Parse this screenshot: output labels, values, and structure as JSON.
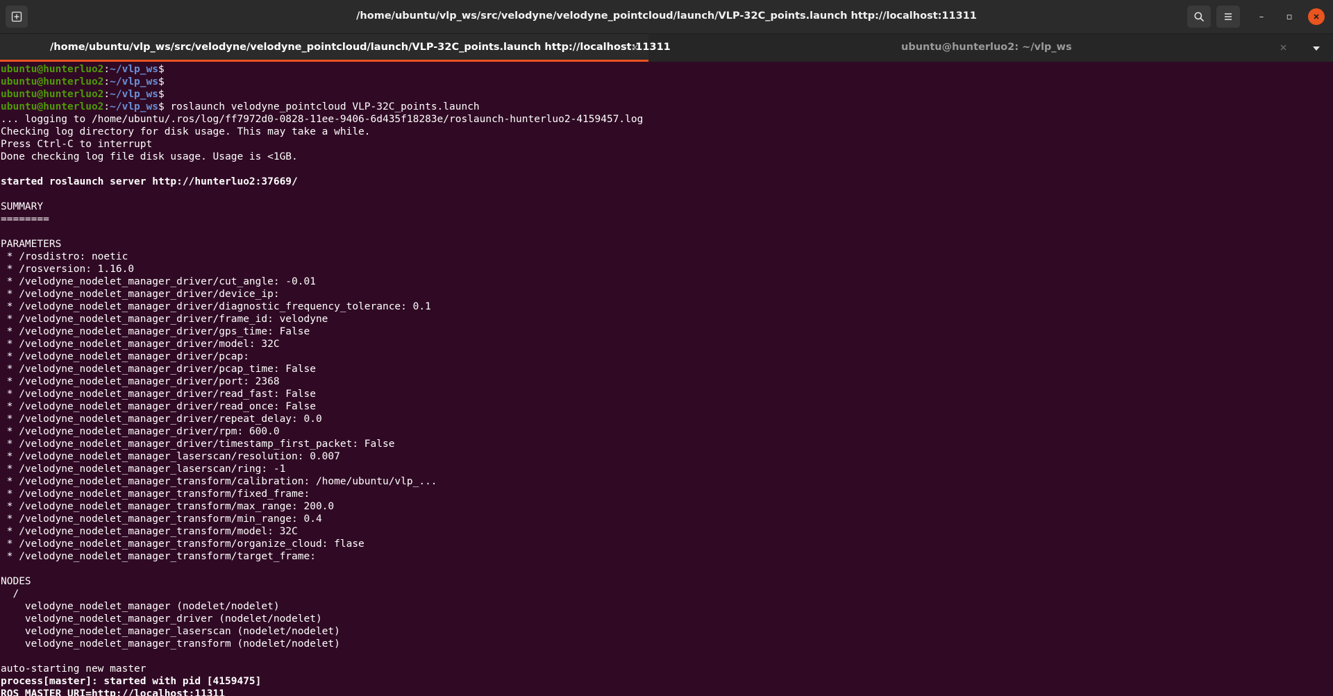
{
  "window": {
    "title": "/home/ubuntu/vlp_ws/src/velodyne/velodyne_pointcloud/launch/VLP-32C_points.launch http://localhost:11311"
  },
  "toolbar": {
    "new_tab_icon": "new-tab-icon",
    "search_icon": "search-icon",
    "menu_icon": "hamburger-menu-icon",
    "minimize_glyph": "–",
    "maximize_glyph": "▫",
    "close_glyph": "✕"
  },
  "tabs": [
    {
      "label": "/home/ubuntu/vlp_ws/src/velodyne/velodyne_pointcloud/launch/VLP-32C_points.launch http://localhost:11311",
      "active": true
    },
    {
      "label": "ubuntu@hunterluo2: ~/vlp_ws",
      "active": false
    }
  ],
  "prompt": {
    "user": "ubuntu@hunterluo2",
    "sep": ":",
    "path": "~/vlp_ws",
    "symbol": "$"
  },
  "prompt_lines": [
    {
      "command": ""
    },
    {
      "command": ""
    },
    {
      "command": ""
    },
    {
      "command": " roslaunch velodyne_pointcloud VLP-32C_points.launch"
    }
  ],
  "output_lines": [
    {
      "text": "... logging to /home/ubuntu/.ros/log/ff7972d0-0828-11ee-9406-6d435f18283e/roslaunch-hunterluo2-4159457.log",
      "bold": false
    },
    {
      "text": "Checking log directory for disk usage. This may take a while.",
      "bold": false
    },
    {
      "text": "Press Ctrl-C to interrupt",
      "bold": false
    },
    {
      "text": "Done checking log file disk usage. Usage is <1GB.",
      "bold": false
    },
    {
      "text": "",
      "bold": false
    },
    {
      "text": "started roslaunch server http://hunterluo2:37669/",
      "bold": true
    },
    {
      "text": "",
      "bold": false
    },
    {
      "text": "SUMMARY",
      "bold": false
    },
    {
      "text": "========",
      "bold": false
    },
    {
      "text": "",
      "bold": false
    },
    {
      "text": "PARAMETERS",
      "bold": false
    },
    {
      "text": " * /rosdistro: noetic",
      "bold": false
    },
    {
      "text": " * /rosversion: 1.16.0",
      "bold": false
    },
    {
      "text": " * /velodyne_nodelet_manager_driver/cut_angle: -0.01",
      "bold": false
    },
    {
      "text": " * /velodyne_nodelet_manager_driver/device_ip:",
      "bold": false
    },
    {
      "text": " * /velodyne_nodelet_manager_driver/diagnostic_frequency_tolerance: 0.1",
      "bold": false
    },
    {
      "text": " * /velodyne_nodelet_manager_driver/frame_id: velodyne",
      "bold": false
    },
    {
      "text": " * /velodyne_nodelet_manager_driver/gps_time: False",
      "bold": false
    },
    {
      "text": " * /velodyne_nodelet_manager_driver/model: 32C",
      "bold": false
    },
    {
      "text": " * /velodyne_nodelet_manager_driver/pcap:",
      "bold": false
    },
    {
      "text": " * /velodyne_nodelet_manager_driver/pcap_time: False",
      "bold": false
    },
    {
      "text": " * /velodyne_nodelet_manager_driver/port: 2368",
      "bold": false
    },
    {
      "text": " * /velodyne_nodelet_manager_driver/read_fast: False",
      "bold": false
    },
    {
      "text": " * /velodyne_nodelet_manager_driver/read_once: False",
      "bold": false
    },
    {
      "text": " * /velodyne_nodelet_manager_driver/repeat_delay: 0.0",
      "bold": false
    },
    {
      "text": " * /velodyne_nodelet_manager_driver/rpm: 600.0",
      "bold": false
    },
    {
      "text": " * /velodyne_nodelet_manager_driver/timestamp_first_packet: False",
      "bold": false
    },
    {
      "text": " * /velodyne_nodelet_manager_laserscan/resolution: 0.007",
      "bold": false
    },
    {
      "text": " * /velodyne_nodelet_manager_laserscan/ring: -1",
      "bold": false
    },
    {
      "text": " * /velodyne_nodelet_manager_transform/calibration: /home/ubuntu/vlp_...",
      "bold": false
    },
    {
      "text": " * /velodyne_nodelet_manager_transform/fixed_frame:",
      "bold": false
    },
    {
      "text": " * /velodyne_nodelet_manager_transform/max_range: 200.0",
      "bold": false
    },
    {
      "text": " * /velodyne_nodelet_manager_transform/min_range: 0.4",
      "bold": false
    },
    {
      "text": " * /velodyne_nodelet_manager_transform/model: 32C",
      "bold": false
    },
    {
      "text": " * /velodyne_nodelet_manager_transform/organize_cloud: flase",
      "bold": false
    },
    {
      "text": " * /velodyne_nodelet_manager_transform/target_frame:",
      "bold": false
    },
    {
      "text": "",
      "bold": false
    },
    {
      "text": "NODES",
      "bold": false
    },
    {
      "text": "  /",
      "bold": false
    },
    {
      "text": "    velodyne_nodelet_manager (nodelet/nodelet)",
      "bold": false
    },
    {
      "text": "    velodyne_nodelet_manager_driver (nodelet/nodelet)",
      "bold": false
    },
    {
      "text": "    velodyne_nodelet_manager_laserscan (nodelet/nodelet)",
      "bold": false
    },
    {
      "text": "    velodyne_nodelet_manager_transform (nodelet/nodelet)",
      "bold": false
    },
    {
      "text": "",
      "bold": false
    },
    {
      "text": "auto-starting new master",
      "bold": false
    },
    {
      "text": "process[master]: started with pid [4159475]",
      "bold": true
    },
    {
      "text": "ROS_MASTER_URI=http://localhost:11311",
      "bold": true
    }
  ]
}
